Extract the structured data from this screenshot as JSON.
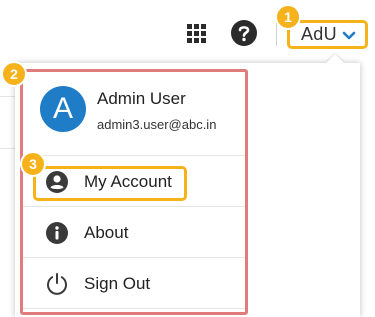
{
  "header": {
    "user_initials": "AdU",
    "icons": [
      "apps-grid-icon",
      "help-icon",
      "chevron-down-icon"
    ]
  },
  "user_menu": {
    "avatar_letter": "A",
    "name": "Admin User",
    "email": "admin3.user@abc.in",
    "items": [
      {
        "label": "My Account",
        "icon": "account-circle-icon"
      },
      {
        "label": "About",
        "icon": "info-icon"
      },
      {
        "label": "Sign Out",
        "icon": "power-icon"
      }
    ]
  },
  "steps": [
    "1",
    "2",
    "3"
  ],
  "colors": {
    "accent": "#f5b21a",
    "highlight": "#e07c7c",
    "avatar": "#1f7cc7",
    "icon": "#3a3a3a"
  }
}
